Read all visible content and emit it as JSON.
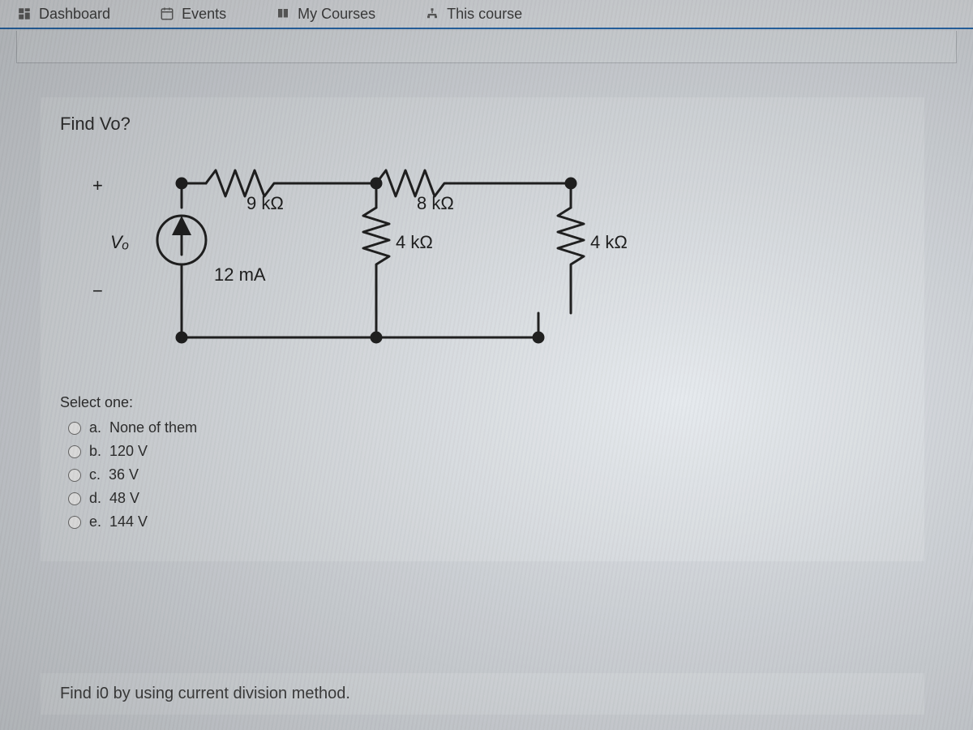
{
  "nav": {
    "dashboard": "Dashboard",
    "events": "Events",
    "mycourses": "My Courses",
    "thiscourse": "This course"
  },
  "question": {
    "title": "Find Vo?",
    "circuit": {
      "r1": "9 kΩ",
      "r2": "8 kΩ",
      "r3": "4 kΩ",
      "r4": "4 kΩ",
      "isrc": "12 mA",
      "vout_plus": "+",
      "vout_minus": "−",
      "vout_label": "Vₒ"
    },
    "select_label": "Select one:",
    "options": [
      {
        "letter": "a.",
        "text": "None of them"
      },
      {
        "letter": "b.",
        "text": "120 V"
      },
      {
        "letter": "c.",
        "text": "36 V"
      },
      {
        "letter": "d.",
        "text": "48 V"
      },
      {
        "letter": "e.",
        "text": "144 V"
      }
    ]
  },
  "next_question": "Find i0 by using current division method."
}
